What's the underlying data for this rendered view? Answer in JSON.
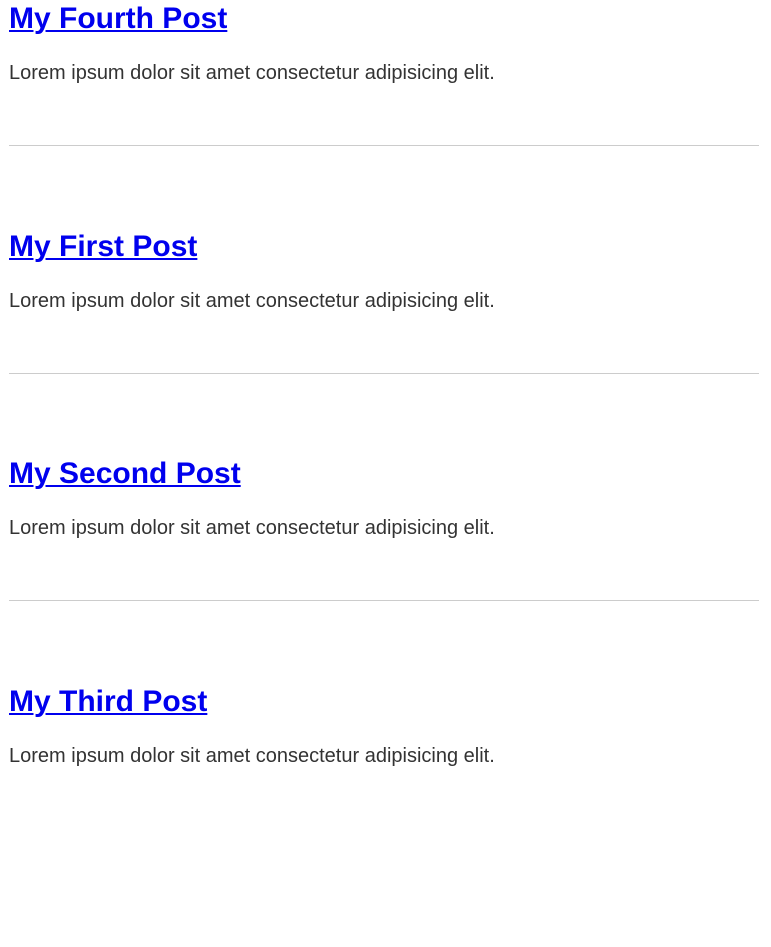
{
  "posts": [
    {
      "title": "My Fourth Post",
      "excerpt": "Lorem ipsum dolor sit amet consectetur adipisicing elit."
    },
    {
      "title": "My First Post",
      "excerpt": "Lorem ipsum dolor sit amet consectetur adipisicing elit."
    },
    {
      "title": "My Second Post",
      "excerpt": "Lorem ipsum dolor sit amet consectetur adipisicing elit."
    },
    {
      "title": "My Third Post",
      "excerpt": "Lorem ipsum dolor sit amet consectetur adipisicing elit."
    }
  ],
  "colors": {
    "link": "#0000ee",
    "text": "#333333",
    "divider": "#cccccc",
    "background": "#ffffff"
  }
}
